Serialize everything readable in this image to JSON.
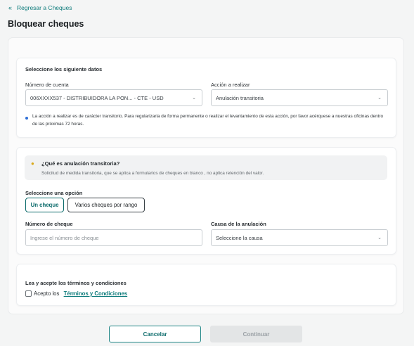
{
  "nav": {
    "back_arrow": "«",
    "back_label": "Regresar a Cheques"
  },
  "page": {
    "title": "Bloquear cheques"
  },
  "account_section": {
    "heading": "Seleccione los siguiente datos",
    "account_label": "Número de cuenta",
    "account_value": "006XXXX537 - DISTRIBUIDORA LA PON... - CTE - USD",
    "action_label": "Acción a realizar",
    "action_value": "Anulación transitoria",
    "note": "La acción a realizar es de carácter transitorio. Para regularizarla de forma permanente o realizar el levantamiento de esta acción, por favor acérquese a nuestras oficinas dentro de las próximas 72 horas."
  },
  "options_section": {
    "info_title": "¿Qué es anulación transitoria?",
    "info_desc": "Solicitud de medida transitoria, que se aplica a formularios de cheques en blanco , no aplica retención del valor.",
    "option_label": "Seleccione una opción",
    "options": [
      "Un cheque",
      "Varios cheques por rango"
    ],
    "selected_option": "Un cheque",
    "check_number_label": "Número de cheque",
    "check_number_placeholder": "Ingrese el número de cheque",
    "cause_label": "Causa de la anulación",
    "cause_value": "Seleccione la causa"
  },
  "terms_section": {
    "heading": "Lea y acepte los términos y condiciones",
    "accept_prefix": "Acepto los",
    "terms_link": "Términos y Condiciones",
    "accepted": false
  },
  "footer": {
    "cancel_label": "Cancelar",
    "continue_label": "Continuar"
  },
  "colors": {
    "accent": "#0b6b6b",
    "link": "#0b7a7a",
    "bullet": "#2f6fd6",
    "disabled_bg": "#e3e5e6"
  },
  "icons": {
    "back": "double-chevron-left-icon",
    "chevron": "chevron-down-icon",
    "info": "lightbulb-icon",
    "bullet": "dot-icon"
  }
}
